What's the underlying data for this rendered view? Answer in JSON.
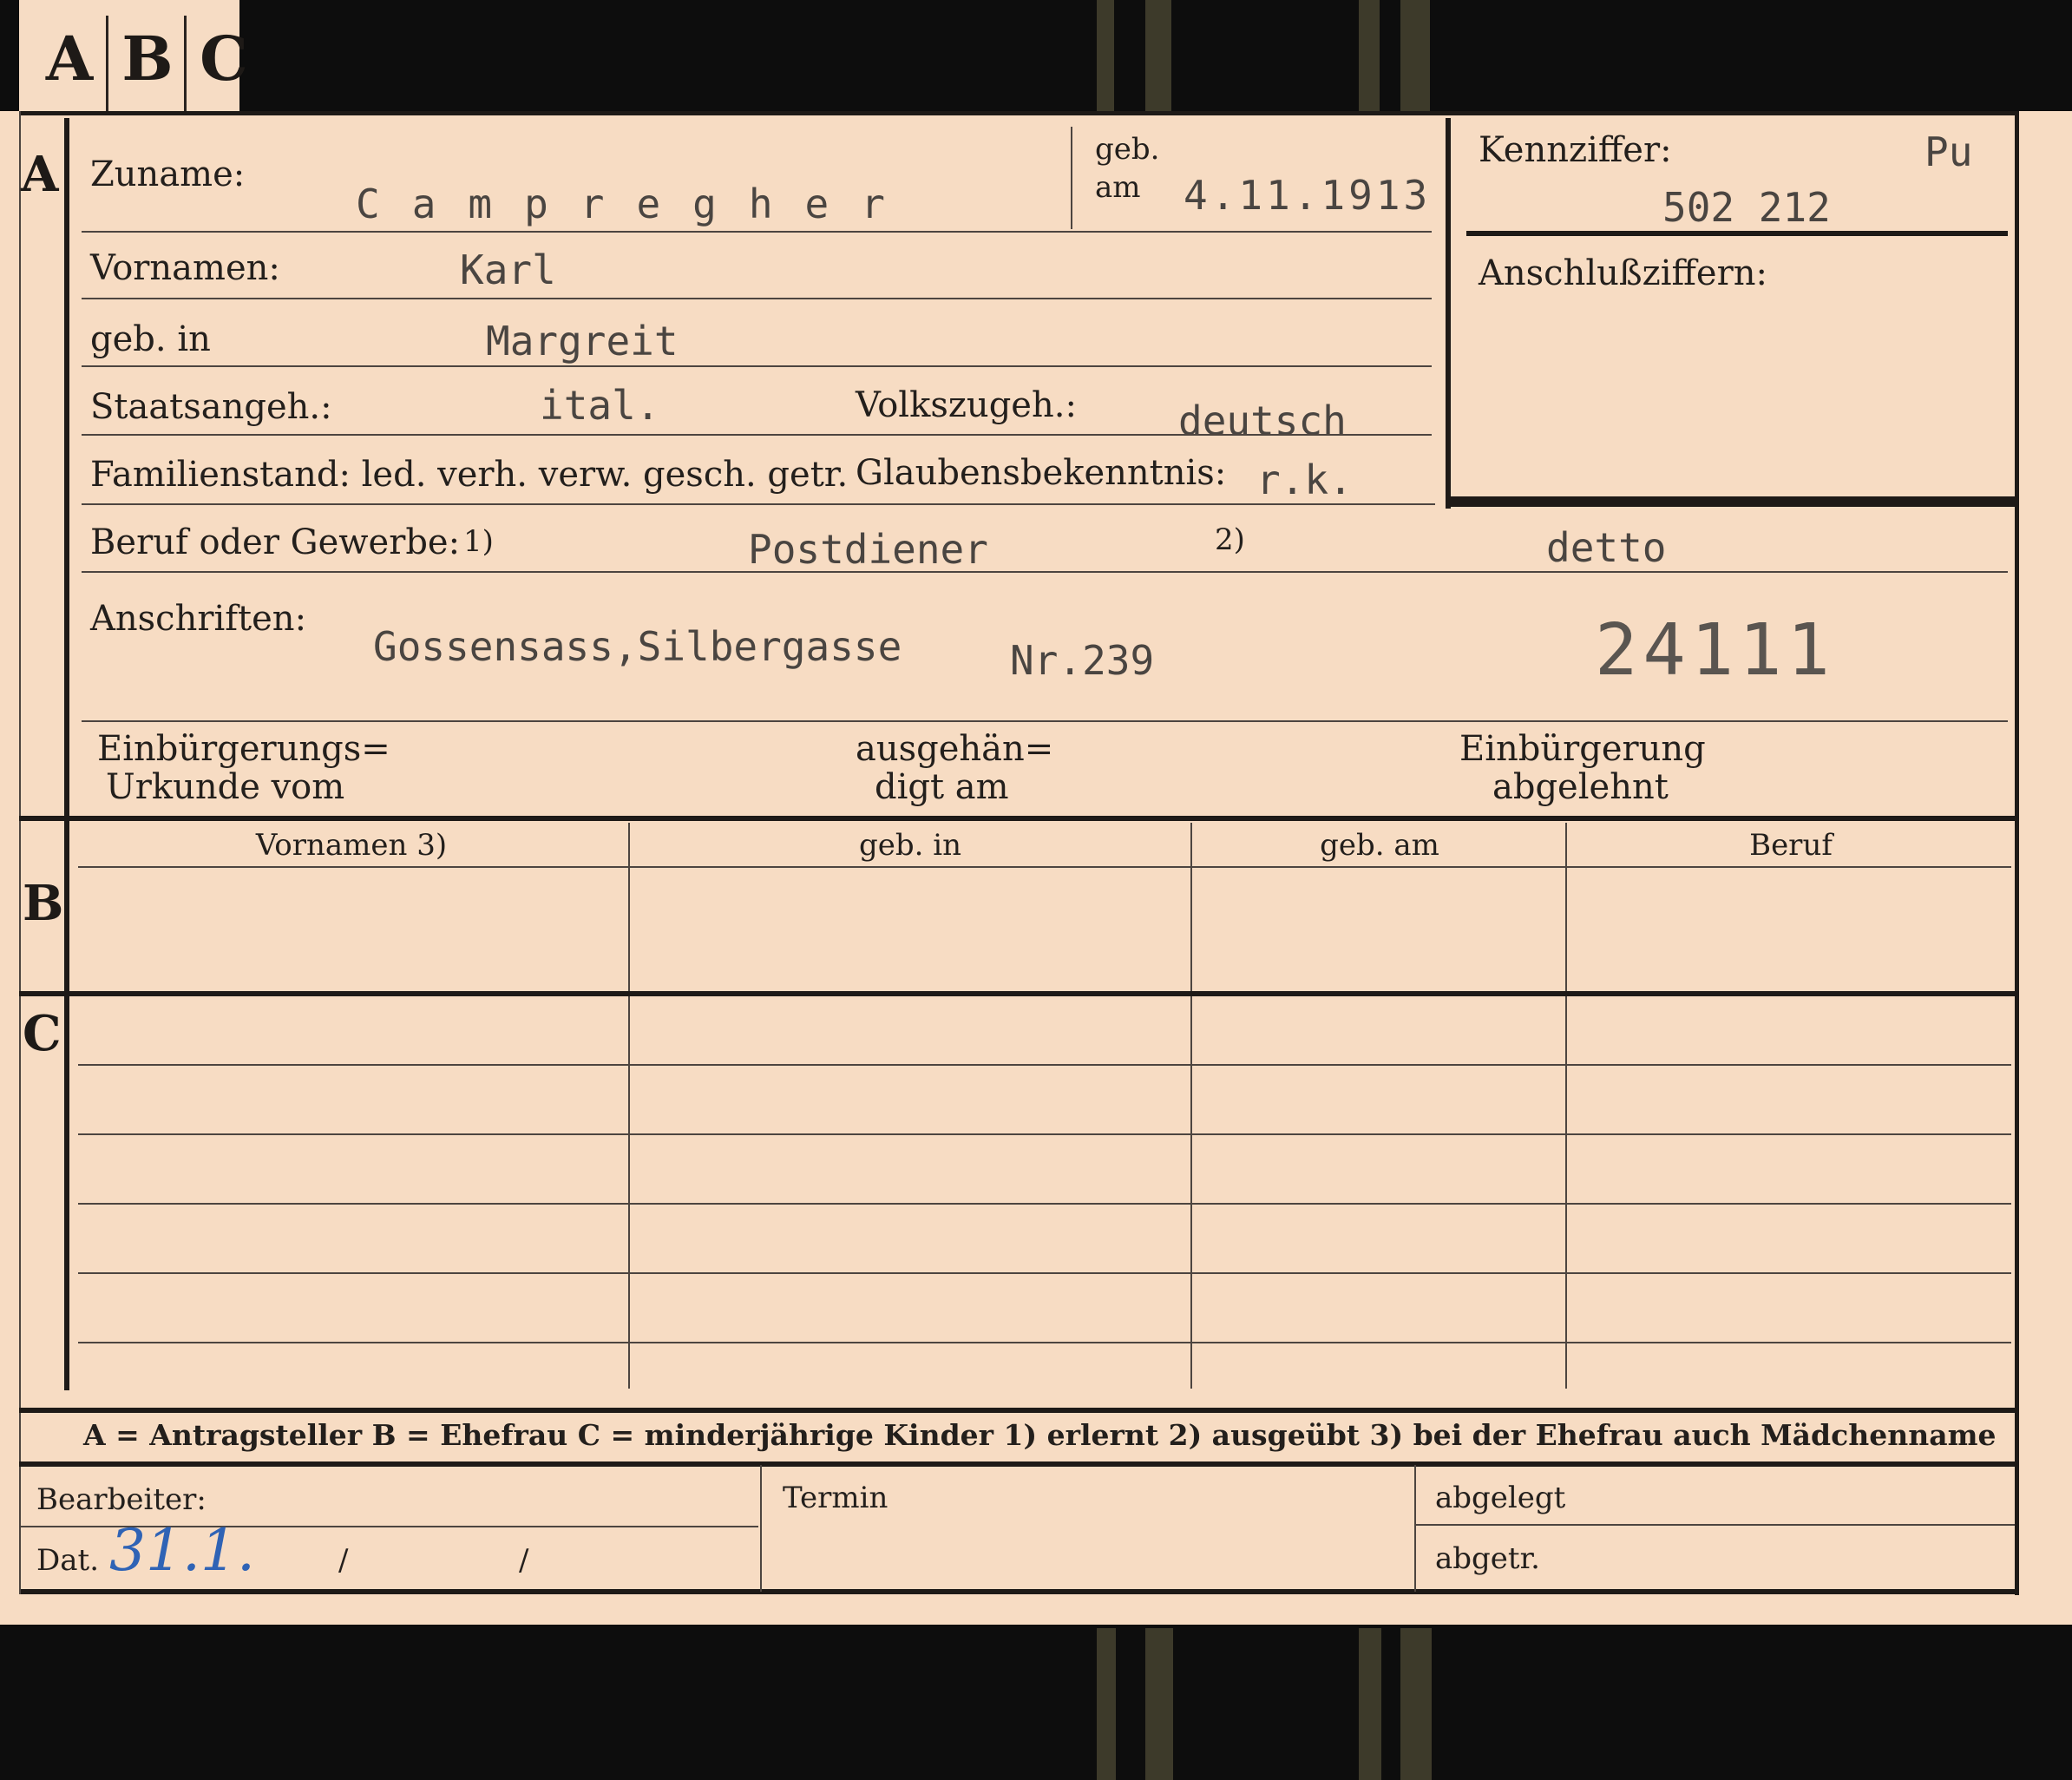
{
  "tab": {
    "letters": [
      "A",
      "B",
      "C"
    ]
  },
  "sections": {
    "a": "A",
    "b": "B",
    "c": "C"
  },
  "personal": {
    "surname_label": "Zuname:",
    "surname_value": "Campregher",
    "born_label_1": "geb.",
    "born_label_2": "am",
    "born_date": "4.11.1913",
    "first_names_label": "Vornamen:",
    "first_names_value": "Karl",
    "birthplace_label": "geb. in",
    "birthplace_value": "Margreit",
    "citizenship_label": "Staatsangeh.:",
    "citizenship_value": "ital.",
    "ethnicity_label": "Volkszugeh.:",
    "ethnicity_value": "deutsch",
    "marital_label": "Familienstand: led. verh. verw. gesch. getr.",
    "religion_label": "Glaubensbekenntnis:",
    "religion_value": "r.k.",
    "occupation_label": "Beruf oder Gewerbe:",
    "note1": "1)",
    "occupation_value_1": "Postdiener",
    "note2": "2)",
    "occupation_value_2": "detto",
    "address_label": "Anschriften:",
    "address_value": "Gossensass,Silbergasse",
    "address_no": "Nr.239",
    "stamp_number": "24111",
    "naturalization_doc_1": "Einbürgerungs=",
    "naturalization_doc_2": "Urkunde vom",
    "handed_over_1": "ausgehän=",
    "handed_over_2": "digt am",
    "naturalization_denied_1": "Einbürgerung",
    "naturalization_denied_2": "abgelehnt"
  },
  "reference": {
    "code_label": "Kennziffer:",
    "code_prefix": "Pu",
    "code_value": "502 212",
    "linked_label": "Anschlußziffern:"
  },
  "table": {
    "columns": [
      "Vornamen 3)",
      "geb. in",
      "geb. am",
      "Beruf"
    ]
  },
  "legend": {
    "text": "A = Antragsteller   B = Ehefrau   C = minderjährige Kinder   1) erlernt   2) ausgeübt   3) bei der Ehefrau auch Mädchenname"
  },
  "footer": {
    "clerk_label": "Bearbeiter:",
    "date_label": "Dat.",
    "date_value": "31.1.",
    "slash1": "/",
    "slash2": "/",
    "deadline_label": "Termin",
    "filed_label": "abgelegt",
    "sent_label": "abgetr."
  }
}
